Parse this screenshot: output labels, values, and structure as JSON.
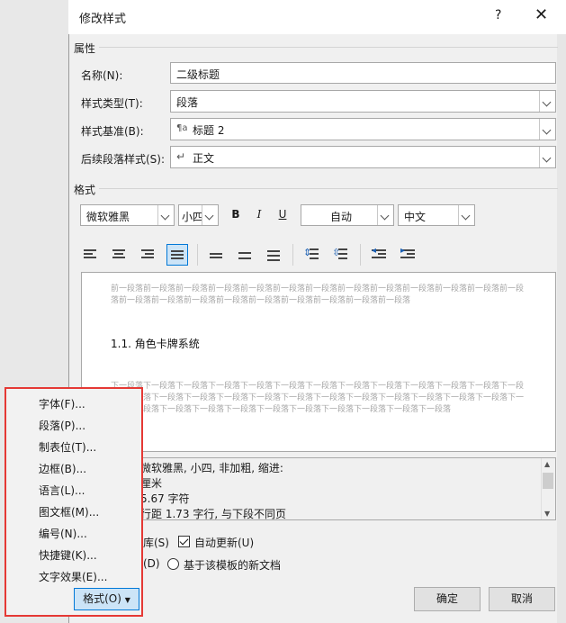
{
  "dialog": {
    "title": "修改样式",
    "help": "?",
    "close": "✕"
  },
  "properties": {
    "section_label": "属性",
    "name_label": "名称(N):",
    "name_value": "二级标题",
    "type_label": "样式类型(T):",
    "type_value": "段落",
    "based_label": "样式基准(B):",
    "based_value": "标题 2",
    "based_icon": "¶a",
    "next_label": "后续段落样式(S):",
    "next_value": "正文",
    "next_icon": "↵"
  },
  "format": {
    "section_label": "格式",
    "font": "微软雅黑",
    "size": "小四",
    "bold": "B",
    "italic": "I",
    "underline": "U",
    "color": "自动",
    "script": "中文"
  },
  "preview": {
    "prev_text": "前一段落前一段落前一段落前一段落前一段落前一段落前一段落前一段落前一段落前一段落前一段落前一段落前一段落前一段落前一段落前一段落前一段落前一段落前一段落前一段落前一段落前一段落",
    "heading": "1.1.   角色卡牌系统",
    "next_text": "下一段落下一段落下一段落下一段落下一段落下一段落下一段落下一段落下一段落下一段落下一段落下一段落下一段落下一段落下一段落下一段落下一段落下一段落下一段落下一段落下一段落下一段落下一段落下一段落下一段落下一段落下一段落下一段落下一段落下一段落下一段落下一段落下一段落下一段落下一段落下一段落"
  },
  "description": {
    "lines": [
      "微软雅黑, 小四, 非加粗, 缩进:",
      "厘米",
      "5.67 字符",
      "行距 1.73 字行, 与下段不同页"
    ]
  },
  "options": {
    "add_gallery": "库(S)",
    "auto_update": "自动更新(U)",
    "only_doc": "(D)",
    "new_template": "基于该模板的新文档"
  },
  "menu": {
    "items": [
      "字体(F)...",
      "段落(P)...",
      "制表位(T)...",
      "边框(B)...",
      "语言(L)...",
      "图文框(M)...",
      "编号(N)...",
      "快捷键(K)...",
      "文字效果(E)..."
    ]
  },
  "buttons": {
    "format": "格式(O)",
    "ok": "确定",
    "cancel": "取消"
  },
  "colors": {
    "accent": "#0078d7",
    "highlight_border": "#e53935"
  }
}
